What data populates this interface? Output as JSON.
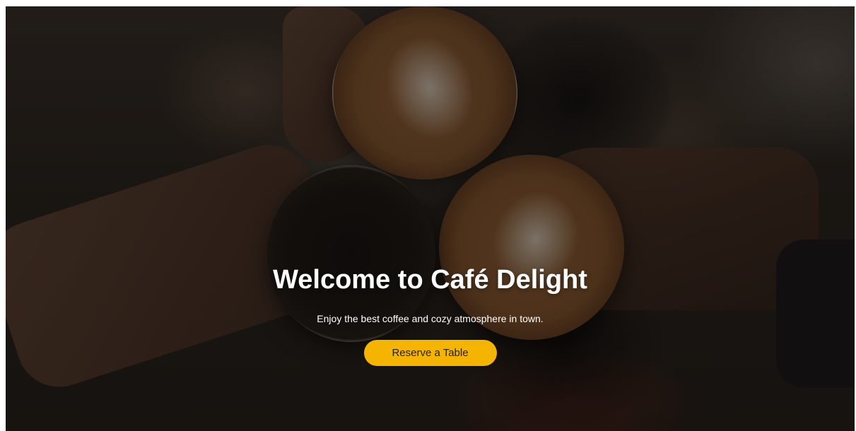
{
  "hero": {
    "title": "Welcome to Café Delight",
    "subtitle": "Enjoy the best coffee and cozy atmosphere in town.",
    "cta_label": "Reserve a Table"
  },
  "colors": {
    "cta_background": "#f4b400",
    "overlay": "rgba(0,0,0,0.45)",
    "text": "#ffffff"
  }
}
